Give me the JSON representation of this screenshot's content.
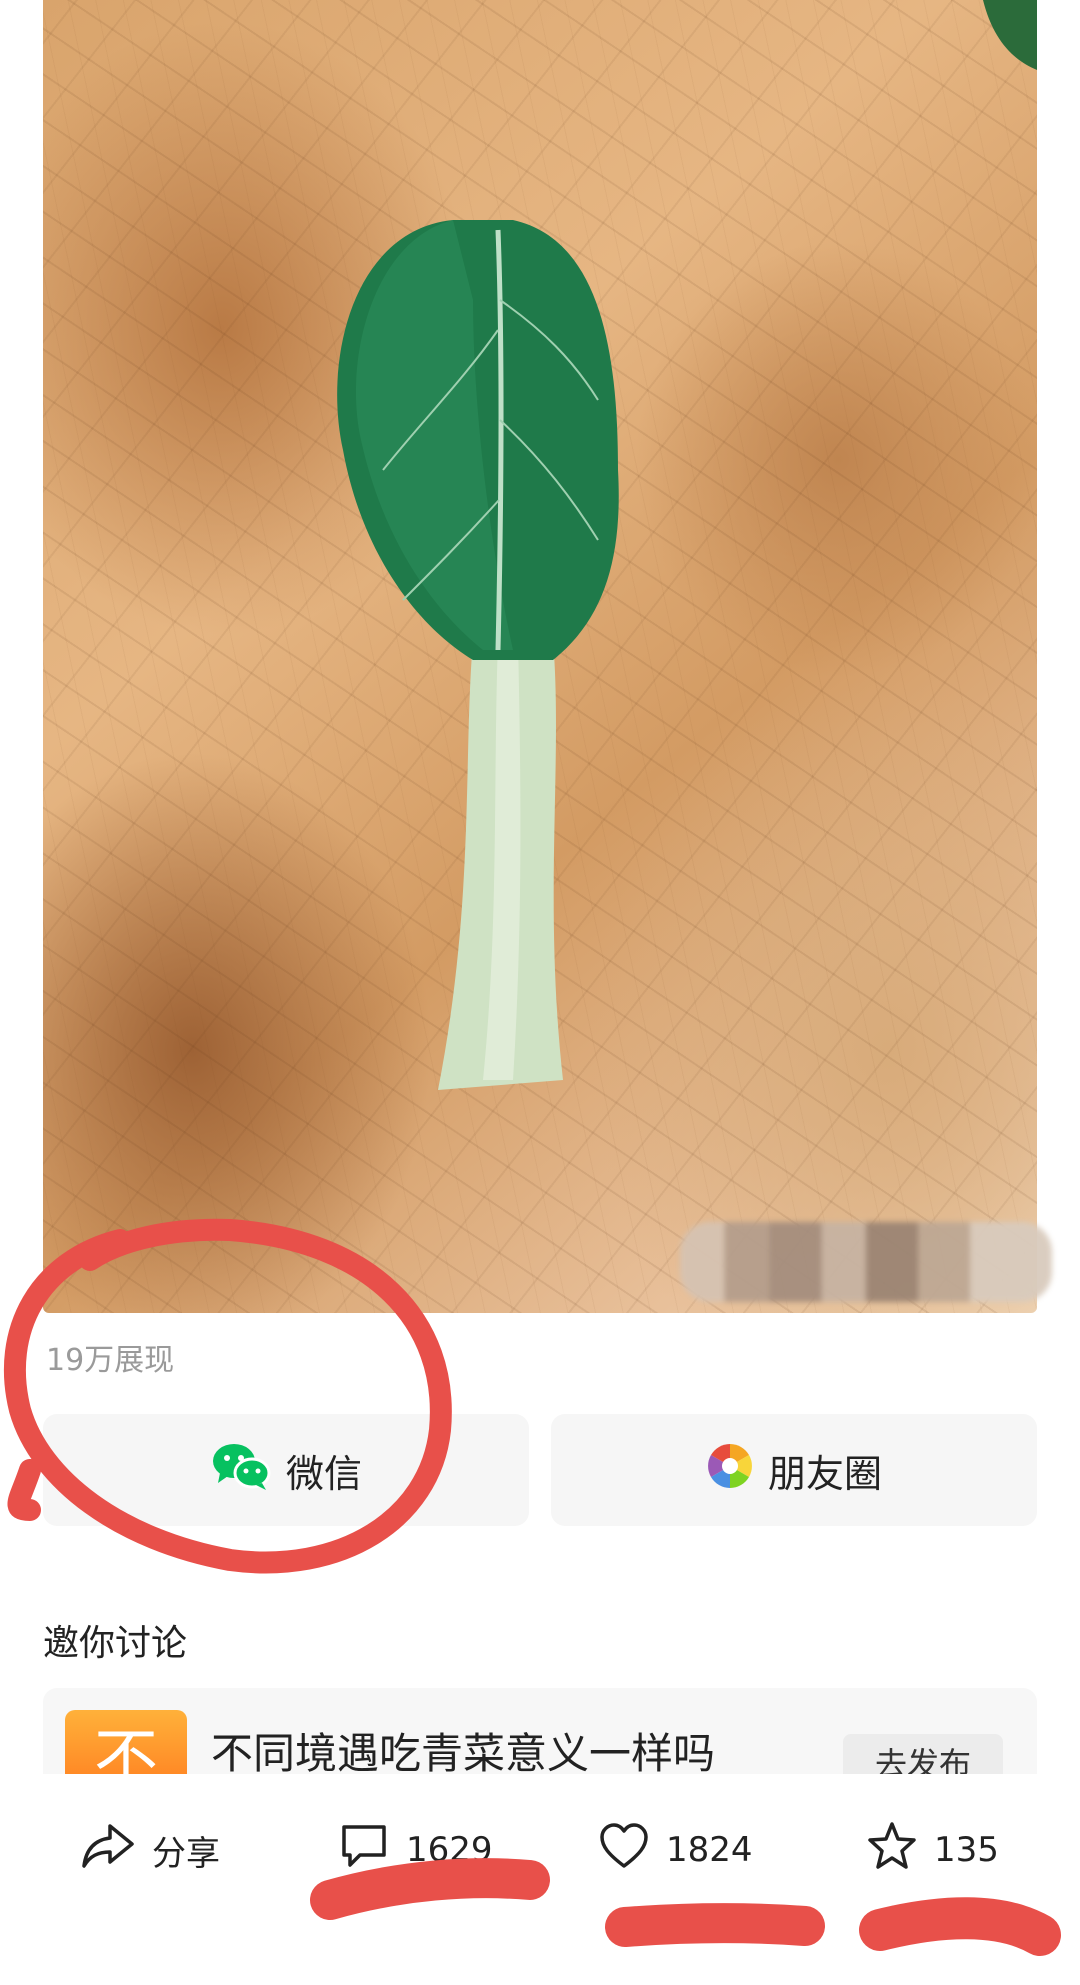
{
  "post": {
    "impressions": "19万展现"
  },
  "share": {
    "wechat_label": "微信",
    "moments_label": "朋友圈"
  },
  "discussion": {
    "title": "邀你讨论",
    "topic_title": "不同境遇吃青菜意义一样吗",
    "topic_thumb_char": "不",
    "topic_button": "去发布"
  },
  "actions": {
    "share_label": "分享",
    "comments": "1629",
    "likes": "1824",
    "favorites": "135"
  },
  "colors": {
    "annotation_red": "#e8504a",
    "wechat_green": "#07c160"
  }
}
